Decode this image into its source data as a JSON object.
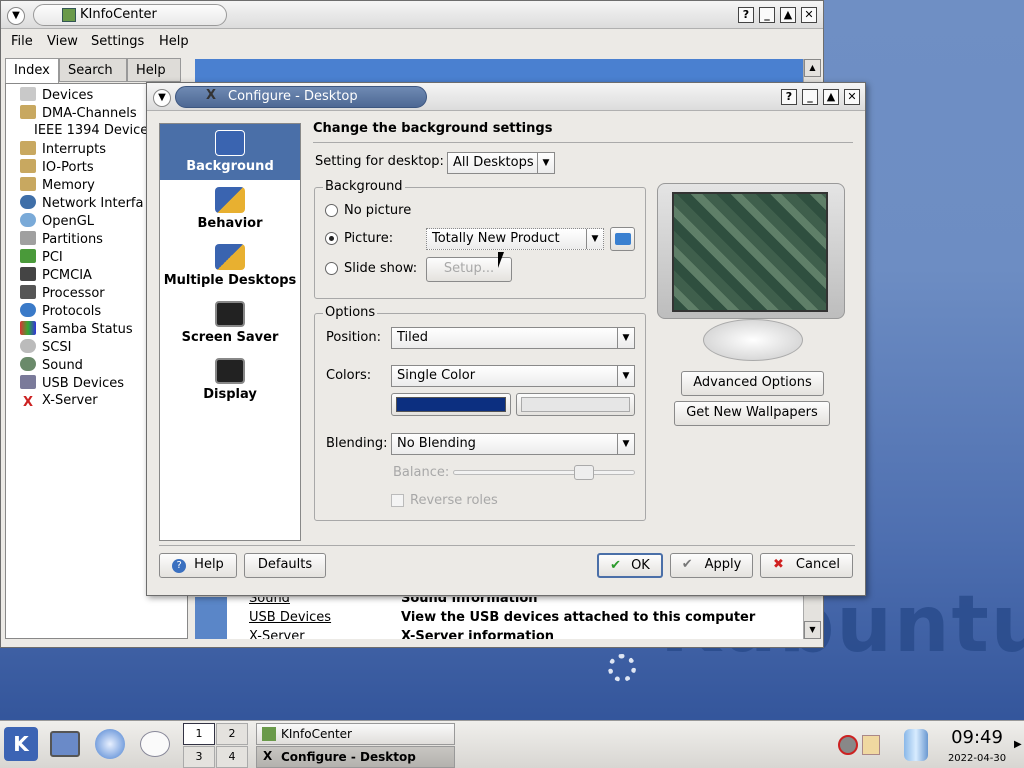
{
  "colors": {
    "accent": "#4a6fa8",
    "color_primary": "#0c2f80",
    "color_secondary": "#e6e6e6",
    "logo": "#2a4c8c"
  },
  "desktop": {
    "logo_text": "Kubuntu"
  },
  "kinfo": {
    "title": "KInfoCenter",
    "menus": [
      "File",
      "View",
      "Settings",
      "Help"
    ],
    "tabs": [
      "Index",
      "Search",
      "Help"
    ],
    "tree": [
      "Devices",
      "DMA-Channels",
      "IEEE 1394 Devices",
      "Interrupts",
      "IO-Ports",
      "Memory",
      "Network Interfa",
      "OpenGL",
      "Partitions",
      "PCI",
      "PCMCIA",
      "Processor",
      "Protocols",
      "Samba Status",
      "SCSI",
      "Sound",
      "USB Devices",
      "X-Server"
    ],
    "table_rows": [
      {
        "name": "Sound",
        "desc": "Sound information"
      },
      {
        "name": "USB Devices",
        "desc": "View the USB devices attached to this computer"
      },
      {
        "name": "X-Server",
        "desc": "X-Server information"
      }
    ]
  },
  "dialog": {
    "title": "Configure - Desktop",
    "header": "Change the background settings",
    "categories": [
      "Background",
      "Behavior",
      "Multiple Desktops",
      "Screen Saver",
      "Display"
    ],
    "setting_for_label": "Setting for desktop:",
    "setting_for_value": "All Desktops",
    "background_group": "Background",
    "no_picture": "No picture",
    "picture": "Picture:",
    "picture_value": "Totally New Product",
    "slide_show": "Slide show:",
    "setup": "Setup...",
    "options_group": "Options",
    "position_label": "Position:",
    "position_value": "Tiled",
    "colors_label": "Colors:",
    "colors_value": "Single Color",
    "blending_label": "Blending:",
    "blending_value": "No Blending",
    "balance_label": "Balance:",
    "reverse_roles": "Reverse roles",
    "advanced": "Advanced Options",
    "get_new": "Get New Wallpapers",
    "help": "Help",
    "defaults": "Defaults",
    "ok": "OK",
    "apply": "Apply",
    "cancel": "Cancel"
  },
  "taskbar": {
    "pager": [
      "1",
      "2",
      "3",
      "4"
    ],
    "tasks": [
      "KInfoCenter",
      "Configure - Desktop"
    ],
    "time": "09:49",
    "date": "2022-04-30"
  }
}
